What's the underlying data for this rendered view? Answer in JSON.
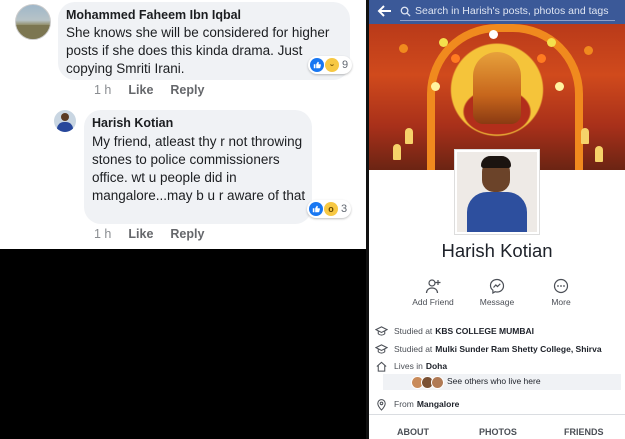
{
  "comments": [
    {
      "author": "Mohammed Faheem Ibn Iqbal",
      "text": "She knows she will be considered for higher posts if she does this kinda drama. Just copying Smriti Irani.",
      "time": "1 h",
      "like_label": "Like",
      "reply_label": "Reply",
      "reaction_count": "9",
      "reactions": [
        "like",
        "haha"
      ]
    },
    {
      "author": "Harish Kotian",
      "text": "My friend, atleast thy r not throwing stones to police commissioners office. wt  u people did in mangalore...may b u r aware of that",
      "time": "1 h",
      "like_label": "Like",
      "reply_label": "Reply",
      "reaction_count": "3",
      "reactions": [
        "like",
        "wow"
      ]
    }
  ],
  "profile": {
    "search_placeholder": "Search in Harish's posts, photos and tags",
    "name": "Harish Kotian",
    "actions": {
      "add_friend": "Add Friend",
      "message": "Message",
      "more": "More"
    },
    "info": {
      "studied_1_prefix": "Studied at",
      "studied_1_place": "KBS COLLEGE MUMBAI",
      "studied_2_prefix": "Studied at",
      "studied_2_place": "Mulki Sunder Ram Shetty College, Shirva",
      "lives_prefix": "Lives in",
      "lives_place": "Doha",
      "see_others": "See others who live here",
      "from_prefix": "From",
      "from_place": "Mangalore"
    },
    "tabs": {
      "about": "ABOUT",
      "photos": "PHOTOS",
      "friends": "FRIENDS"
    }
  },
  "colors": {
    "facebook_blue": "#3b5998",
    "like_blue": "#1877f2",
    "bubble_gray": "#f0f2f5"
  }
}
